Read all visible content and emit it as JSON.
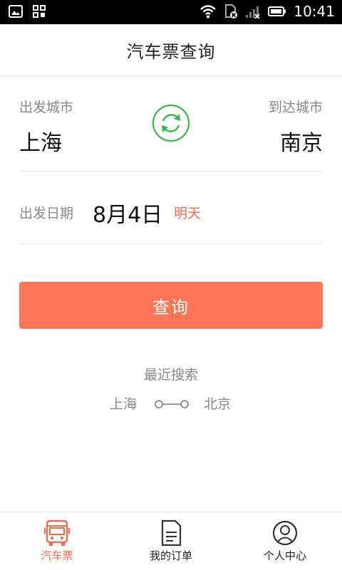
{
  "status_bar": {
    "time": "10:41"
  },
  "header": {
    "title": "汽车票查询"
  },
  "cities": {
    "from_label": "出发城市",
    "from_city": "上海",
    "to_label": "到达城市",
    "to_city": "南京"
  },
  "date": {
    "label": "出发日期",
    "value": "8月4日",
    "tag": "明天"
  },
  "query_button": {
    "label": "查询"
  },
  "recent": {
    "title": "最近搜索",
    "from": "上海",
    "to": "北京"
  },
  "tabs": [
    {
      "label": "汽车票",
      "icon": "bus-icon",
      "active": true
    },
    {
      "label": "我的订单",
      "icon": "order-document-icon",
      "active": false
    },
    {
      "label": "个人中心",
      "icon": "user-profile-icon",
      "active": false
    }
  ],
  "colors": {
    "accent": "#fd7556",
    "accent_text": "#f06a4c",
    "swap_green": "#3cb54a"
  }
}
